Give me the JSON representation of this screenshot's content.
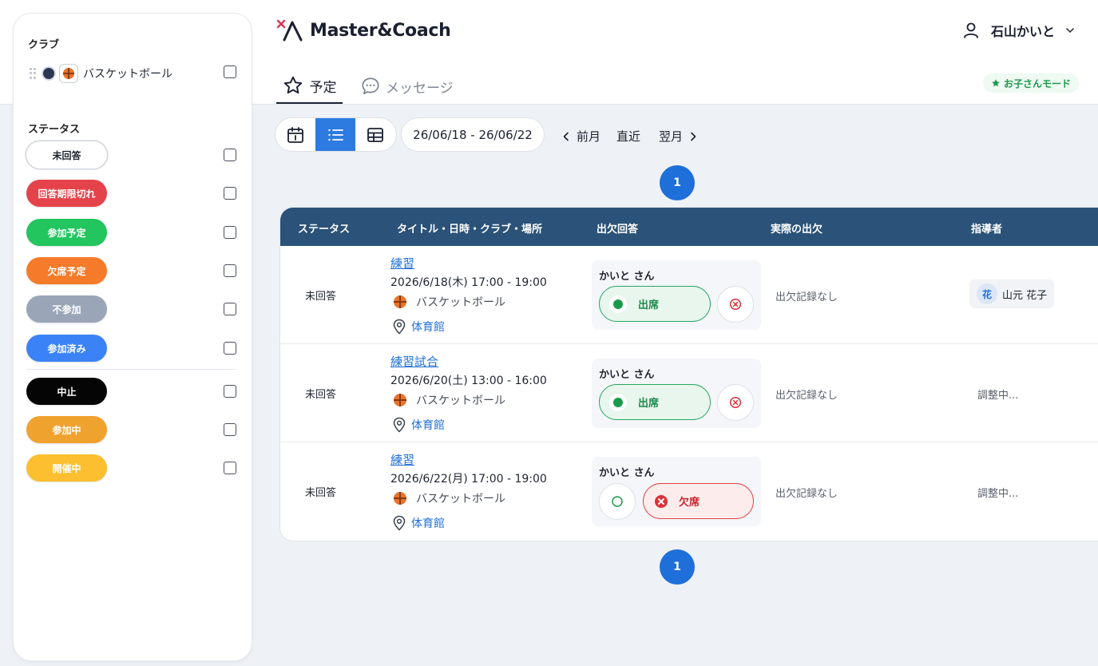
{
  "sidebar": {
    "club_title": "クラブ",
    "club_name": "バスケットボール",
    "status_title": "ステータス",
    "statuses": [
      {
        "label": "未回答",
        "color": "#ffffff",
        "text_color": "#1f2430"
      },
      {
        "label": "回答期限切れ",
        "color": "#e5434a",
        "text_color": "#ffffff"
      },
      {
        "label": "参加予定",
        "color": "#22c55e",
        "text_color": "#ffffff"
      },
      {
        "label": "欠席予定",
        "color": "#f57b2a",
        "text_color": "#ffffff"
      },
      {
        "label": "不参加",
        "color": "#9aa6b8",
        "text_color": "#ffffff"
      },
      {
        "label": "参加済み",
        "color": "#3b82f6",
        "text_color": "#ffffff"
      },
      {
        "label": "中止",
        "color": "#050505",
        "text_color": "#ffffff"
      },
      {
        "label": "参加中",
        "color": "#f0a22e",
        "text_color": "#ffffff"
      },
      {
        "label": "開催中",
        "color": "#fbbf2f",
        "text_color": "#ffffff"
      }
    ]
  },
  "header": {
    "app_name": "Master&Coach",
    "user_name": "石山かいと",
    "tabs": [
      {
        "label": "予定",
        "icon": "star-icon"
      },
      {
        "label": "メッセージ",
        "icon": "chat-bubble-icon"
      }
    ],
    "mode_badge": "お子さんモード"
  },
  "toolbar": {
    "date_range": "26/06/18 - 26/06/22",
    "prev_label": "前月",
    "current_label": "直近",
    "next_label": "翌月"
  },
  "pagination": {
    "page": "1"
  },
  "table": {
    "columns": [
      "ステータス",
      "タイトル・日時・クラブ・場所",
      "出欠回答",
      "実際の出欠",
      "指導者"
    ],
    "rows": [
      {
        "status": "未回答",
        "title": "練習",
        "datetime": "2026/6/18(木) 17:00 - 19:00",
        "club": "バスケットボール",
        "place": "体育館",
        "responder": "かいと さん",
        "response": "attend",
        "attend_label": "出席",
        "actual": "出欠記録なし",
        "coach_initial": "花",
        "coach": "山元 花子"
      },
      {
        "status": "未回答",
        "title": "練習試合",
        "datetime": "2026/6/20(土) 13:00 - 16:00",
        "club": "バスケットボール",
        "place": "体育館",
        "responder": "かいと さん",
        "response": "attend",
        "attend_label": "出席",
        "actual": "出欠記録なし",
        "coach": "調整中..."
      },
      {
        "status": "未回答",
        "title": "練習",
        "datetime": "2026/6/22(月) 17:00 - 19:00",
        "club": "バスケットボール",
        "place": "体育館",
        "responder": "かいと さん",
        "response": "absent",
        "absent_label": "欠席",
        "actual": "出欠記録なし",
        "coach": "調整中..."
      }
    ]
  }
}
